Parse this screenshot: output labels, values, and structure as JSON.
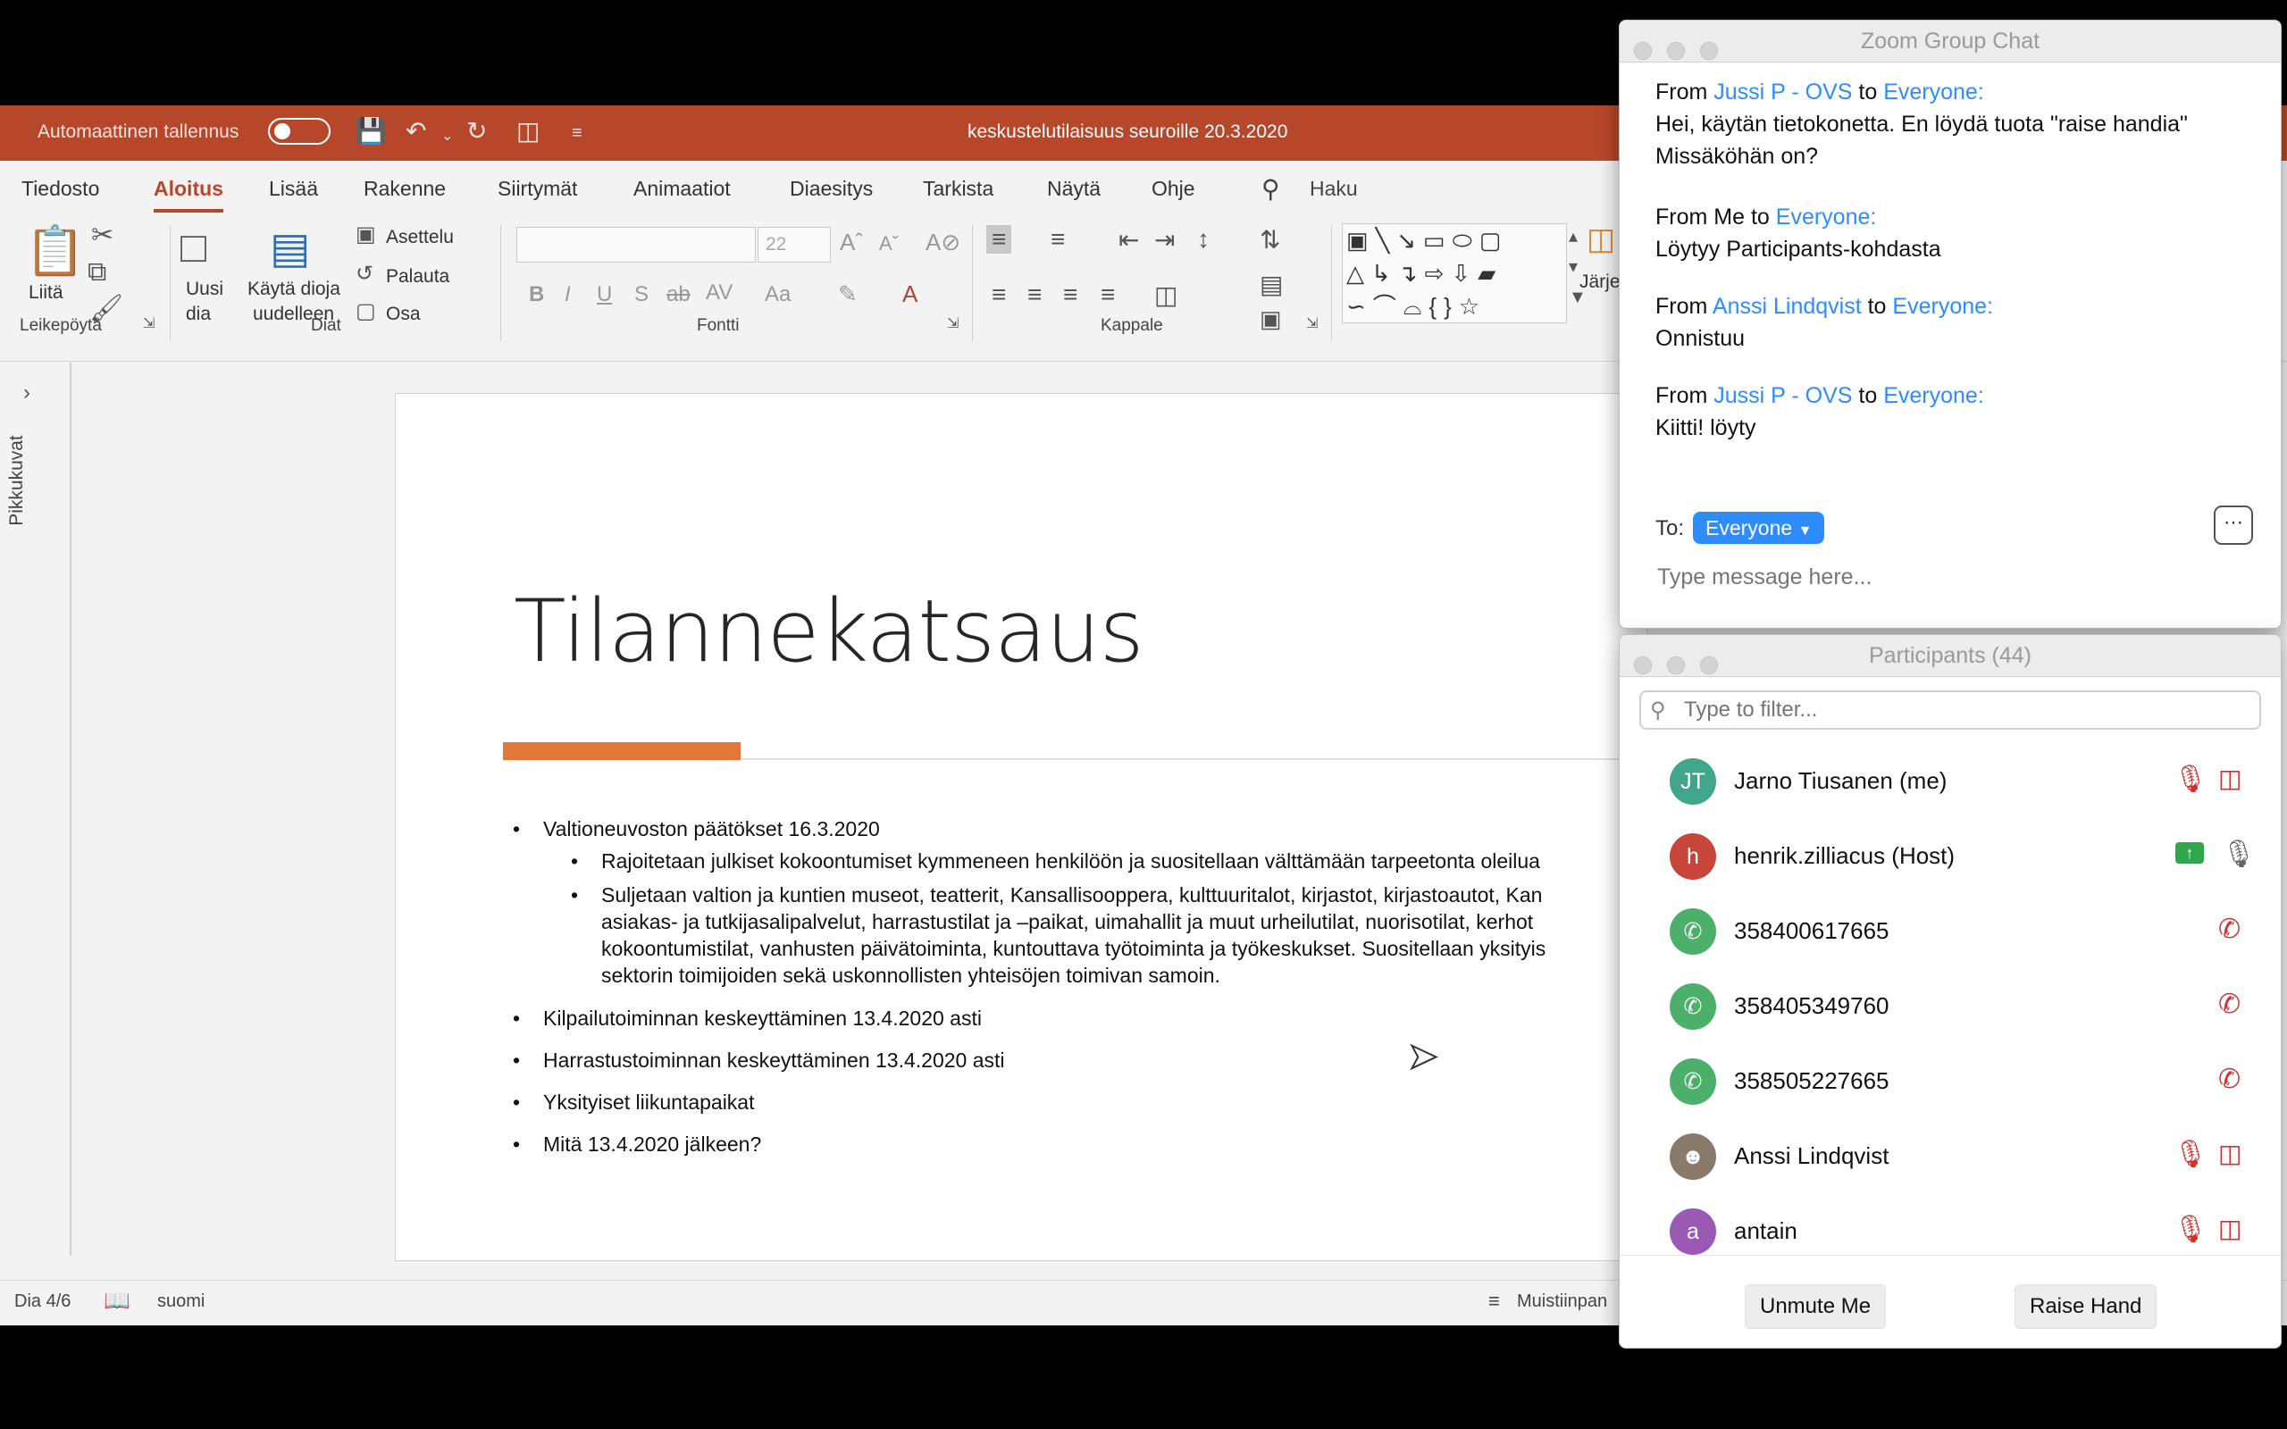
{
  "ppt": {
    "autosave_label": "Automaattinen tallennus",
    "document_title": "keskustelutilaisuus seuroille 20.3.2020",
    "tabs": [
      "Tiedosto",
      "Aloitus",
      "Lisää",
      "Rakenne",
      "Siirtymät",
      "Animaatiot",
      "Diaesitys",
      "Tarkista",
      "Näytä",
      "Ohje"
    ],
    "search_label": "Haku",
    "ribbon": {
      "paste_label": "Liitä",
      "clipboard_group": "Leikepöytä",
      "new_slide_line1": "Uusi",
      "new_slide_line2": "dia",
      "reuse_line1": "Käytä dioja",
      "reuse_line2": "uudelleen",
      "layout_label": "Asettelu",
      "reset_label": "Palauta",
      "section_label": "Osa",
      "slides_group": "Diat",
      "font_size": "22",
      "font_group": "Fontti",
      "paragraph_group": "Kappale",
      "arrange_label": "Järje"
    },
    "thumbnails_label": "Pikkukuvat",
    "slide": {
      "title": "Tilannekatsaus",
      "bullet1": "Valtioneuvoston päätökset 16.3.2020",
      "sub1": "Rajoitetaan julkiset kokoontumiset kymmeneen henkilöön ja suositellaan välttämään tarpeetonta oleilua",
      "sub2_line1": "Suljetaan valtion ja kuntien museot, teatterit, Kansallisooppera, kulttuuritalot, kirjastot, kirjastoautot, Kan",
      "sub2_line2": "asiakas- ja tutkijasalipalvelut, harrastustilat ja –paikat, uimahallit ja muut urheilutilat, nuorisotilat, kerhot",
      "sub2_line3": "kokoontumistilat, vanhusten päivätoiminta, kuntouttava työtoiminta ja työkeskukset. Suositellaan yksityis",
      "sub2_line4": "sektorin toimijoiden sekä uskonnollisten yhteisöjen toimivan samoin.",
      "bullet2": "Kilpailutoiminnan keskeyttäminen 13.4.2020 asti",
      "bullet3": "Harrastustoiminnan keskeyttäminen 13.4.2020 asti",
      "bullet4": "Yksityiset liikuntapaikat",
      "bullet5": "Mitä 13.4.2020 jälkeen?"
    },
    "status": {
      "slide_counter": "Dia 4/6",
      "language": "suomi",
      "notes_label": "Muistiinpan"
    }
  },
  "chat": {
    "title": "Zoom Group Chat",
    "messages": [
      {
        "from_prefix": "From",
        "sender": "Jussi P - OVS",
        "to_word": "to",
        "recipient": "Everyone",
        "text_line1": "Hei, käytän tietokonetta. En löydä tuota \"raise handia\"",
        "text_line2": "Missäköhän on?"
      },
      {
        "from_prefix": "From",
        "sender": "Me",
        "to_word": "to",
        "recipient": "Everyone",
        "text_line1": "Löytyy Participants-kohdasta"
      },
      {
        "from_prefix": "From",
        "sender": "Anssi Lindqvist",
        "to_word": "to",
        "recipient": "Everyone",
        "text_line1": "Onnistuu"
      },
      {
        "from_prefix": "From",
        "sender": "Jussi P - OVS",
        "to_word": "to",
        "recipient": "Everyone",
        "text_line1": "Kiitti! löyty"
      }
    ],
    "to_label": "To:",
    "to_value": "Everyone",
    "input_placeholder": "Type message here..."
  },
  "participants": {
    "title": "Participants (44)",
    "filter_placeholder": "Type to filter...",
    "list": [
      {
        "initials": "JT",
        "name": "Jarno Tiusanen (me)",
        "avatar_color": "#3fa68c",
        "mic": "muted",
        "video": "off"
      },
      {
        "initials": "h",
        "name": "henrik.zilliacus (Host)",
        "avatar_color": "#c8453a",
        "mic": "on",
        "sharing": "true"
      },
      {
        "initials": "",
        "name": "358400617665",
        "avatar_color": "#4cb06a",
        "phone": "muted"
      },
      {
        "initials": "",
        "name": "358405349760",
        "avatar_color": "#4cb06a",
        "phone": "muted"
      },
      {
        "initials": "",
        "name": "358505227665",
        "avatar_color": "#4cb06a",
        "phone": "muted"
      },
      {
        "initials": "",
        "name": "Anssi Lindqvist",
        "avatar_color": "#8a7a6a",
        "mic": "muted",
        "video": "off"
      },
      {
        "initials": "a",
        "name": "antain",
        "avatar_color": "#9b59b6",
        "mic": "muted",
        "video": "off"
      }
    ],
    "unmute_label": "Unmute Me",
    "raise_hand_label": "Raise Hand"
  },
  "colors": {
    "ppt_accent": "#b7472a",
    "zoom_blue": "#2d8cff",
    "muted_red": "#d0312d"
  }
}
